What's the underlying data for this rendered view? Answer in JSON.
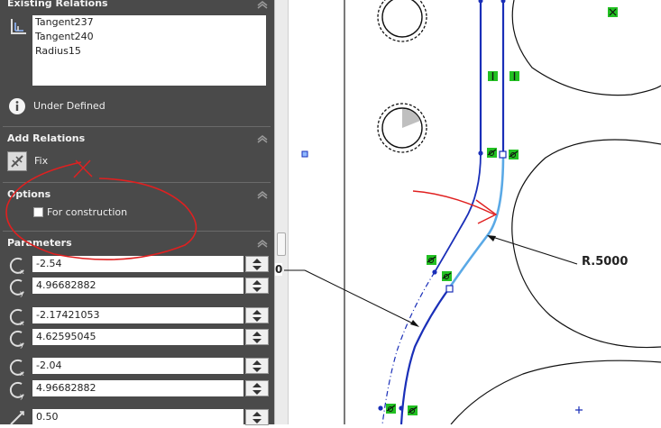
{
  "existing_relations": {
    "title": "Existing Relations",
    "items": [
      "Tangent237",
      "Tangent240",
      "Radius15"
    ],
    "status": "Under Defined"
  },
  "add_relations": {
    "title": "Add Relations",
    "fix_label": "Fix"
  },
  "options": {
    "title": "Options",
    "for_construction_label": "For construction",
    "for_construction_checked": false
  },
  "parameters": {
    "title": "Parameters",
    "values": [
      "-2.54",
      "4.96682882",
      "-2.17421053",
      "4.62595045",
      "-2.04",
      "4.96682882",
      "0.50"
    ]
  },
  "drawing": {
    "dimension_label": "R.5000",
    "left_cut_label": "0"
  },
  "colors": {
    "panel_bg": "#4a4a4a",
    "sketch_blue": "#1a2fb8",
    "selected_arc": "#5aa9e6",
    "annotation_red": "#e02020",
    "relation_green": "#22c022"
  }
}
